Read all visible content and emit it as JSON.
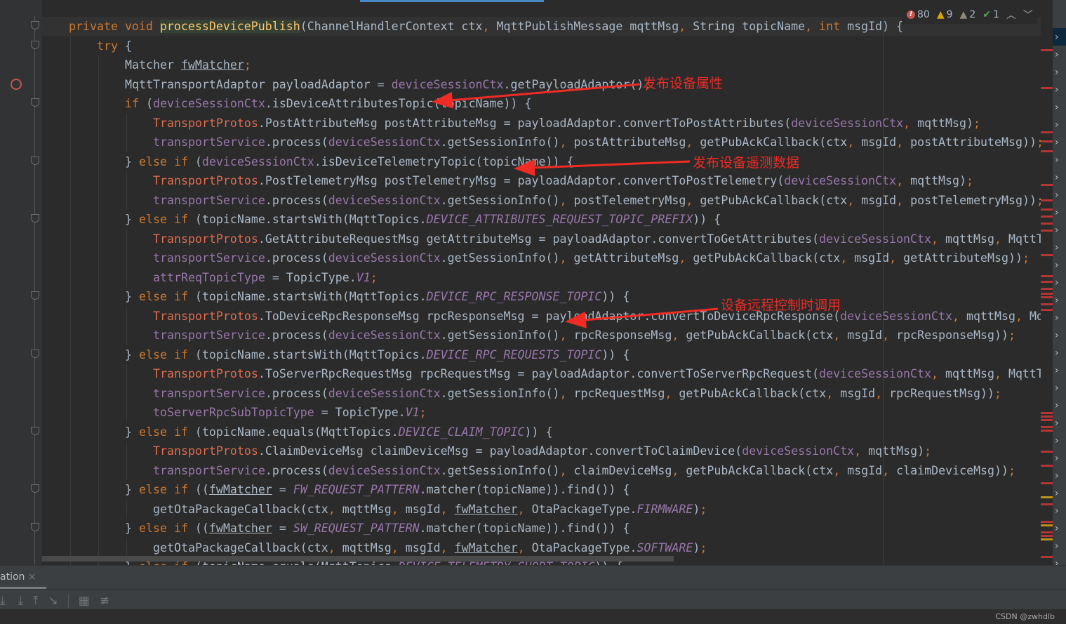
{
  "inspections": {
    "errors": "80",
    "warnings": "9",
    "weak_warnings": "2",
    "typos": "1"
  },
  "code_lines": [
    {
      "indent": 0,
      "text": "private void processDevicePublish(ChannelHandlerContext ctx, MqttPublishMessage mqttMsg, String topicName, int msgId) {"
    },
    {
      "indent": 1,
      "text": "try {"
    },
    {
      "indent": 2,
      "text": "Matcher fwMatcher;"
    },
    {
      "indent": 2,
      "text": "MqttTransportAdaptor payloadAdaptor = deviceSessionCtx.getPayloadAdaptor();"
    },
    {
      "indent": 2,
      "text": "if (deviceSessionCtx.isDeviceAttributesTopic(topicName)) {"
    },
    {
      "indent": 3,
      "text": "TransportProtos.PostAttributeMsg postAttributeMsg = payloadAdaptor.convertToPostAttributes(deviceSessionCtx, mqttMsg);"
    },
    {
      "indent": 3,
      "text": "transportService.process(deviceSessionCtx.getSessionInfo(), postAttributeMsg, getPubAckCallback(ctx, msgId, postAttributeMsg));"
    },
    {
      "indent": 2,
      "text": "} else if (deviceSessionCtx.isDeviceTelemetryTopic(topicName)) {"
    },
    {
      "indent": 3,
      "text": "TransportProtos.PostTelemetryMsg postTelemetryMsg = payloadAdaptor.convertToPostTelemetry(deviceSessionCtx, mqttMsg);"
    },
    {
      "indent": 3,
      "text": "transportService.process(deviceSessionCtx.getSessionInfo(), postTelemetryMsg, getPubAckCallback(ctx, msgId, postTelemetryMsg));"
    },
    {
      "indent": 2,
      "text": "} else if (topicName.startsWith(MqttTopics.DEVICE_ATTRIBUTES_REQUEST_TOPIC_PREFIX)) {"
    },
    {
      "indent": 3,
      "text": "TransportProtos.GetAttributeRequestMsg getAttributeMsg = payloadAdaptor.convertToGetAttributes(deviceSessionCtx, mqttMsg, MqttTo"
    },
    {
      "indent": 3,
      "text": "transportService.process(deviceSessionCtx.getSessionInfo(), getAttributeMsg, getPubAckCallback(ctx, msgId, getAttributeMsg));"
    },
    {
      "indent": 3,
      "text": "attrReqTopicType = TopicType.V1;"
    },
    {
      "indent": 2,
      "text": "} else if (topicName.startsWith(MqttTopics.DEVICE_RPC_RESPONSE_TOPIC)) {"
    },
    {
      "indent": 3,
      "text": "TransportProtos.ToDeviceRpcResponseMsg rpcResponseMsg = payloadAdaptor.convertToDeviceRpcResponse(deviceSessionCtx, mqttMsg, Mqt"
    },
    {
      "indent": 3,
      "text": "transportService.process(deviceSessionCtx.getSessionInfo(), rpcResponseMsg, getPubAckCallback(ctx, msgId, rpcResponseMsg));"
    },
    {
      "indent": 2,
      "text": "} else if (topicName.startsWith(MqttTopics.DEVICE_RPC_REQUESTS_TOPIC)) {"
    },
    {
      "indent": 3,
      "text": "TransportProtos.ToServerRpcRequestMsg rpcRequestMsg = payloadAdaptor.convertToServerRpcRequest(deviceSessionCtx, mqttMsg, MqttTo"
    },
    {
      "indent": 3,
      "text": "transportService.process(deviceSessionCtx.getSessionInfo(), rpcRequestMsg, getPubAckCallback(ctx, msgId, rpcRequestMsg));"
    },
    {
      "indent": 3,
      "text": "toServerRpcSubTopicType = TopicType.V1;"
    },
    {
      "indent": 2,
      "text": "} else if (topicName.equals(MqttTopics.DEVICE_CLAIM_TOPIC)) {"
    },
    {
      "indent": 3,
      "text": "TransportProtos.ClaimDeviceMsg claimDeviceMsg = payloadAdaptor.convertToClaimDevice(deviceSessionCtx, mqttMsg);"
    },
    {
      "indent": 3,
      "text": "transportService.process(deviceSessionCtx.getSessionInfo(), claimDeviceMsg, getPubAckCallback(ctx, msgId, claimDeviceMsg));"
    },
    {
      "indent": 2,
      "text": "} else if ((fwMatcher = FW_REQUEST_PATTERN.matcher(topicName)).find()) {"
    },
    {
      "indent": 3,
      "text": "getOtaPackageCallback(ctx, mqttMsg, msgId, fwMatcher, OtaPackageType.FIRMWARE);"
    },
    {
      "indent": 2,
      "text": "} else if ((fwMatcher = SW_REQUEST_PATTERN.matcher(topicName)).find()) {"
    },
    {
      "indent": 3,
      "text": "getOtaPackageCallback(ctx, mqttMsg, msgId, fwMatcher, OtaPackageType.SOFTWARE);"
    },
    {
      "indent": 2,
      "text": "} else if (topicName.equals(MqttTopics.DEVICE_TELEMETRY_SHORT_TOPIC)) {"
    }
  ],
  "annotations": {
    "publish_attributes": "发布设备属性",
    "publish_telemetry": "发布设备遥测数据",
    "rpc_call": "设备远程控制时调用"
  },
  "bottom_panel": {
    "tab_label": "ation",
    "close": "×"
  },
  "watermark": "CSDN @zwhdlb",
  "colors": {
    "annotation": "#ee2b24",
    "keyword": "#cc7832",
    "field": "#9876aa",
    "background": "#2b2b2b"
  }
}
